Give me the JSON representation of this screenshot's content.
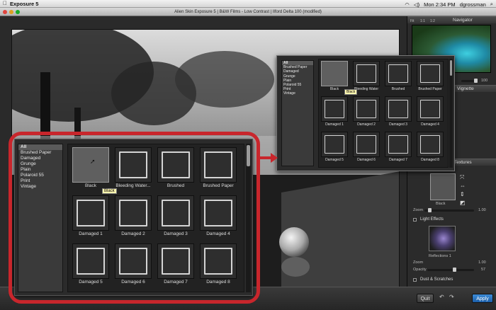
{
  "menubar": {
    "app": "Exposure 5",
    "clock": "Mon 2:34 PM",
    "user": "dgrossman"
  },
  "window": {
    "title": "Alien Skin Exposure 5 | B&W Films - Low Contrast | Ilford Delta 100 (modified)"
  },
  "navigator": {
    "title": "Navigator",
    "zoom_tabs": [
      "Fit",
      "1:1",
      "1:2"
    ]
  },
  "vignette": {
    "title": "Vignette",
    "value": "100"
  },
  "textures": {
    "title": "Textures",
    "selected_label": "Black",
    "zoom_label": "Zoom",
    "zoom_value": "1.00",
    "light_effects_label": "Light Effects",
    "reflections_label": "Reflections 1",
    "light_zoom_value": "1.00",
    "opacity_label": "Opacity",
    "opacity_value": "57",
    "dust_label": "Dust & Scratches"
  },
  "buttons": {
    "quit": "Quit",
    "apply": "Apply"
  },
  "categories": [
    "All",
    "Brushed Paper",
    "Damaged",
    "Grunge",
    "Plain",
    "Polaroid 55",
    "Print",
    "Vintage"
  ],
  "thumbnails_large": [
    "Black",
    "Bleeding Water...",
    "Brushed",
    "Brushed Paper",
    "Damaged 1",
    "Damaged 2",
    "Damaged 3",
    "Damaged 4",
    "Damaged 5",
    "Damaged 6",
    "Damaged 7",
    "Damaged 8"
  ],
  "thumbnails_small": [
    "Black",
    "Bleeding Water",
    "Brushed",
    "Brushed Paper",
    "Damaged 1",
    "Damaged 2",
    "Damaged 3",
    "Damaged 4",
    "Damaged 5",
    "Damaged 6",
    "Damaged 7",
    "Damaged 8"
  ],
  "tooltip": "Black",
  "colors": {
    "highlight_ring": "#c8262c",
    "apply_button": "#2a74c4",
    "tooltip_bg": "#fff7b0"
  }
}
